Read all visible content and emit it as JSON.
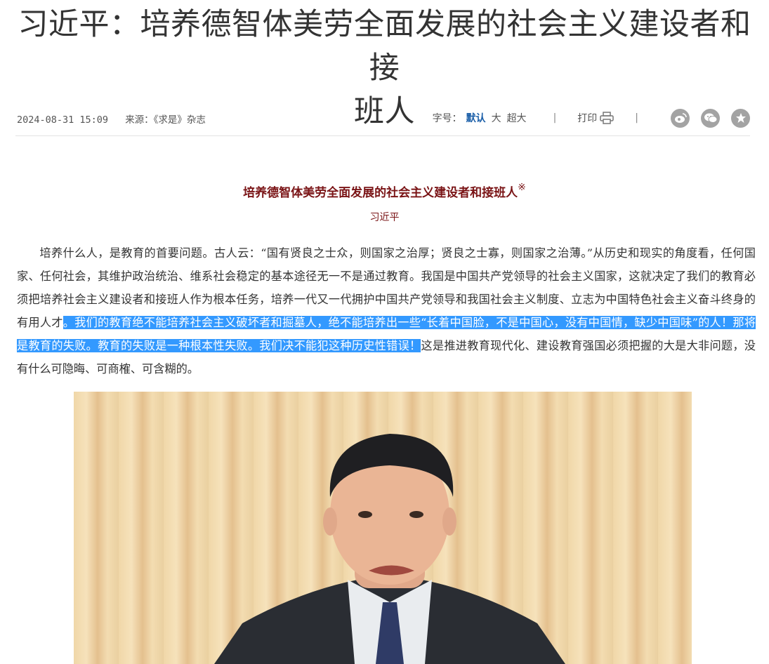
{
  "article": {
    "title_line1": "习近平：培养德智体美劳全面发展的社会主义建设者和接",
    "title_line2": "班人",
    "date": "2024-08-31 15:09",
    "source": "来源：《求是》杂志",
    "font_size_label": "字号：",
    "font_sizes": [
      "默认",
      "大",
      "超大"
    ],
    "print_label": "打印",
    "share_icons": [
      "weibo-icon",
      "wechat-icon",
      "favorite-icon"
    ],
    "sub_title": "培养德智体美劳全面发展的社会主义建设者和接班人",
    "sub_title_mark": "※",
    "author": "习近平",
    "paragraph_before": "培养什么人，是教育的首要问题。古人云：“国有贤良之士众，则国家之治厚；贤良之士寡，则国家之治薄。”从历史和现实的角度看，任何国家、任何社会，其维护政治统治、维系社会稳定的基本途径无一不是通过教育。我国是中国共产党领导的社会主义国家，这就决定了我们的教育必须把培养社会主义建设者和接班人作为根本任务，培养一代又一代拥护中国共产党领导和我国社会主义制度、立志为中国特色社会主义奋斗终身的有用人才",
    "paragraph_highlight": "。我们的教育绝不能培养社会主义破坏者和掘墓人，绝不能培养出一些“长着中国脸，不是中国心，没有中国情，缺少中国味”的人！那将是教育的失败。教育的失败是一种根本性失败。我们决不能犯这种历史性错误！",
    "paragraph_after": "这是推进教育现代化、建设教育强国必须把握的大是大非问题，没有什么可隐晦、可商榷、可含糊的。",
    "highlight_color": "#3399ff",
    "accent_color": "#7a1416"
  }
}
